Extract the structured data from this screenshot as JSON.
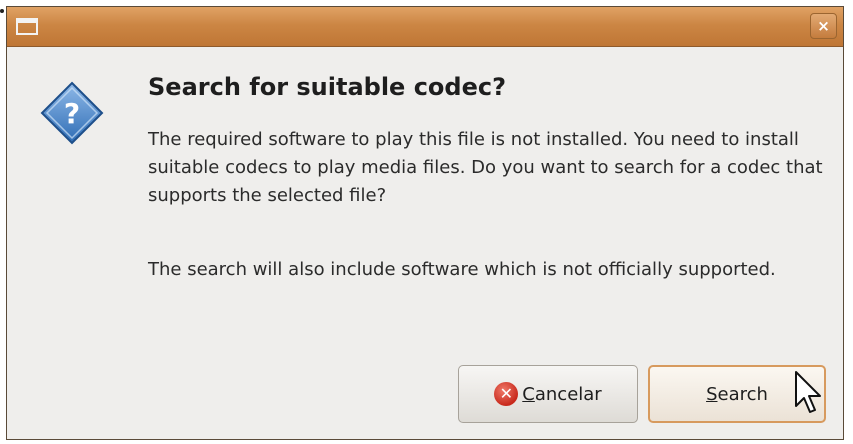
{
  "dialog": {
    "close_glyph": "×",
    "icon": "question-icon",
    "title": "Search for suitable codec?",
    "message": "The required software to play this file is not installed. You need to install suitable codecs to play media files. Do you want to search for a codec that supports the selected file?",
    "secondary": "The search will also include software which is not officially supported."
  },
  "buttons": {
    "cancel": {
      "mnemonic": "C",
      "rest": "ancelar",
      "icon": "cancel-icon"
    },
    "search": {
      "mnemonic": "S",
      "rest": "earch"
    }
  },
  "colors": {
    "titlebar": "#cc8644",
    "dialog_bg": "#efeeec",
    "focus_border": "#d79a5e",
    "icon_blue": "#3b7cc4",
    "cancel_red": "#c8291c"
  }
}
